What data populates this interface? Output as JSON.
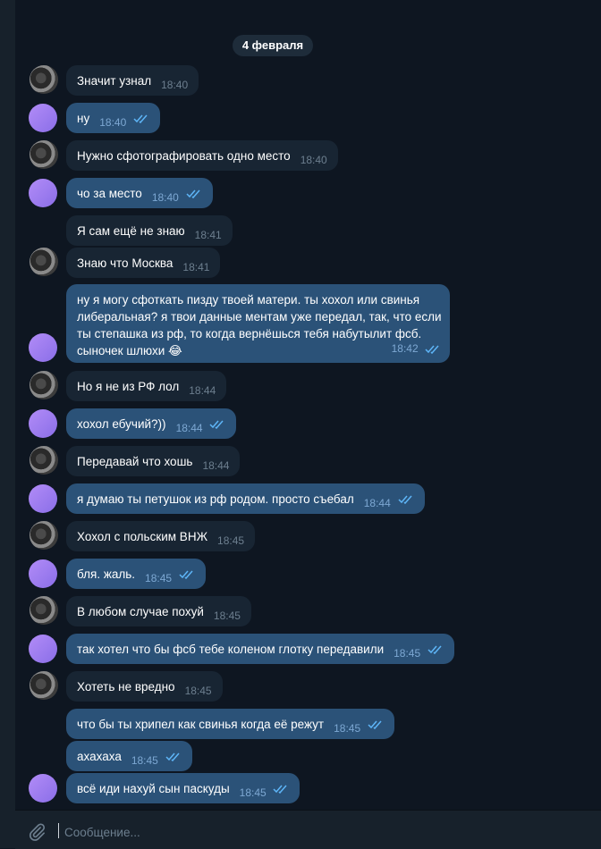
{
  "date_label": "4 февраля",
  "messages": [
    {
      "text": "Значит узнал",
      "time": "18:40"
    },
    {
      "text": "ну",
      "time": "18:40"
    },
    {
      "text": "Нужно сфотографировать одно место",
      "time": "18:40"
    },
    {
      "text": "чо за место",
      "time": "18:40"
    },
    {
      "text": "Я сам ещё не знаю",
      "time": "18:41"
    },
    {
      "text": "Знаю что Москва",
      "time": "18:41"
    },
    {
      "lines": [
        "ну я могу сфоткать пизду твоей матери. ты хохол или свинья",
        "либеральная? я твои данные ментам уже передал, так, что если",
        "ты степашка из рф, то когда вернёшься тебя набутылит фсб.",
        "сыночек шлюхи 😂"
      ],
      "time": "18:42"
    },
    {
      "text": "Но я не из РФ лол",
      "time": "18:44"
    },
    {
      "text": "хохол ебучий?))",
      "time": "18:44"
    },
    {
      "text": "Передавай что хошь",
      "time": "18:44"
    },
    {
      "text": "я думаю ты петушок из рф родом. просто съебал",
      "time": "18:44"
    },
    {
      "text": "Хохол с польским ВНЖ",
      "time": "18:45"
    },
    {
      "text": "бля. жаль.",
      "time": "18:45"
    },
    {
      "text": "В любом случае похуй",
      "time": "18:45"
    },
    {
      "text": "так хотел что бы фсб тебе коленом глотку передавили",
      "time": "18:45"
    },
    {
      "text": "Хотеть не вредно",
      "time": "18:45"
    },
    {
      "text": "что бы ты хрипел как свинья когда её режут",
      "time": "18:45"
    },
    {
      "text": "ахахаха",
      "time": "18:45"
    },
    {
      "text": "всё иди нахуй сын паскуды",
      "time": "18:45"
    }
  ],
  "composer": {
    "placeholder": "Сообщение..."
  },
  "icons": {
    "attach": "paperclip-icon",
    "read": "double-check-icon"
  },
  "colors": {
    "background": "#0e1621",
    "incoming": "#182533",
    "outgoing": "#2b5278",
    "accent": "#5eb5f7"
  }
}
